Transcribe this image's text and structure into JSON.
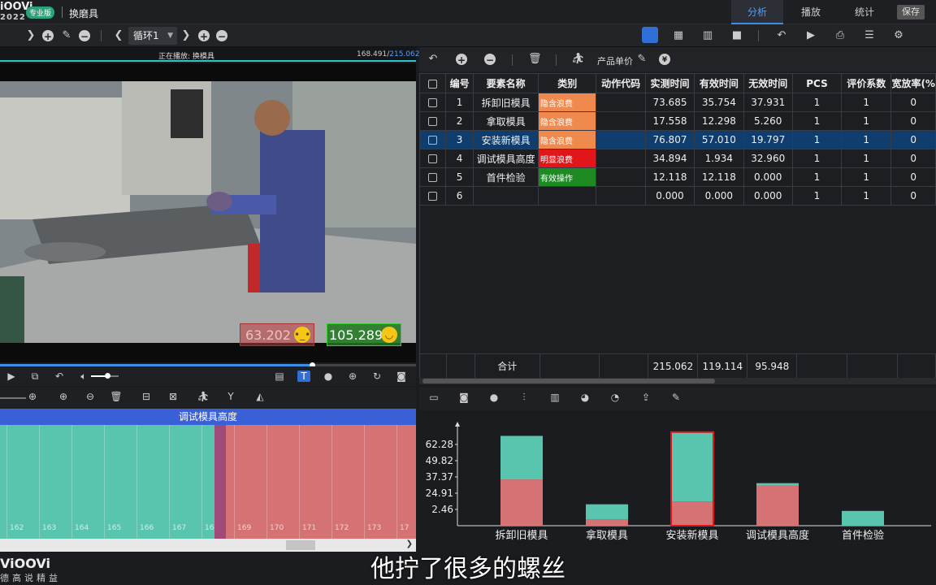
{
  "app": {
    "logo": "iOOVi",
    "year": "2022",
    "edition_badge": "专业版",
    "window_title": "换磨具",
    "tabs": [
      "分析",
      "播放",
      "统计"
    ],
    "save_label": "保存"
  },
  "toolbar": {
    "cycle_value": "循环1"
  },
  "video": {
    "now_playing": "正在播放: 换模具",
    "time_current": "168.491/",
    "time_total": "215.062",
    "timer_waste": "63.202",
    "timer_valid": "105.289",
    "progress": 0.75,
    "volume": 0.6
  },
  "timeline": {
    "current_element": "调试模具高度",
    "ticks": [
      "162",
      "163",
      "164",
      "165",
      "166",
      "167",
      "16",
      "169",
      "170",
      "171",
      "172",
      "173",
      "17"
    ]
  },
  "right_toolbar": {
    "price_label": "产品单价"
  },
  "table": {
    "headers": [
      "",
      "编号",
      "要素名称",
      "类别",
      "动作代码",
      "实测时间",
      "有效时间",
      "无效时间",
      "PCS",
      "评价系数",
      "宽放率(%"
    ],
    "rows": [
      {
        "no": "1",
        "name": "拆卸旧模具",
        "cat": "隐含浪费",
        "cat_color": "#f0894e",
        "code": "",
        "measured": "73.685",
        "valid": "35.754",
        "invalid": "37.931",
        "pcs": "1",
        "coef": "1",
        "allow": "0"
      },
      {
        "no": "2",
        "name": "拿取模具",
        "cat": "隐含浪费",
        "cat_color": "#f0894e",
        "code": "",
        "measured": "17.558",
        "valid": "12.298",
        "invalid": "5.260",
        "pcs": "1",
        "coef": "1",
        "allow": "0"
      },
      {
        "no": "3",
        "name": "安装新模具",
        "cat": "隐含浪费",
        "cat_color": "#f0894e",
        "code": "",
        "measured": "76.807",
        "valid": "57.010",
        "invalid": "19.797",
        "pcs": "1",
        "coef": "1",
        "allow": "0"
      },
      {
        "no": "4",
        "name": "调试模具高度",
        "cat": "明显浪费",
        "cat_color": "#e0161b",
        "code": "",
        "measured": "34.894",
        "valid": "1.934",
        "invalid": "32.960",
        "pcs": "1",
        "coef": "1",
        "allow": "0"
      },
      {
        "no": "5",
        "name": "首件检验",
        "cat": "有效操作",
        "cat_color": "#1d8a24",
        "code": "",
        "measured": "12.118",
        "valid": "12.118",
        "invalid": "0.000",
        "pcs": "1",
        "coef": "1",
        "allow": "0"
      },
      {
        "no": "6",
        "name": "",
        "cat": "",
        "cat_color": "",
        "code": "",
        "measured": "0.000",
        "valid": "0.000",
        "invalid": "0.000",
        "pcs": "1",
        "coef": "1",
        "allow": "0"
      }
    ],
    "selected_row": 2,
    "total": {
      "label": "合计",
      "measured": "215.062",
      "valid": "119.114",
      "invalid": "95.948"
    }
  },
  "colors": {
    "valid": "#5ac5ae",
    "invalid": "#d57274",
    "accent": "#3a8ee6"
  },
  "chart_data": {
    "type": "bar",
    "stacked": true,
    "categories": [
      "拆卸旧模具",
      "拿取模具",
      "安装新模具",
      "调试模具高度",
      "首件检验"
    ],
    "series": [
      {
        "values": [
          37.931,
          5.26,
          19.797,
          32.96,
          0.0
        ]
      },
      {
        "values": [
          35.754,
          12.298,
          57.01,
          1.934,
          12.118
        ]
      }
    ],
    "y_tick_labels": [
      "2.46",
      "24.91",
      "37.37",
      "49.82",
      "62.28"
    ],
    "ylim": [
      0,
      80
    ],
    "highlighted_category": "安装新模具"
  },
  "subtitle": "他拧了很多的螺丝",
  "footer": {
    "brand": "ViOOVi",
    "slogan": "德高说精益"
  }
}
